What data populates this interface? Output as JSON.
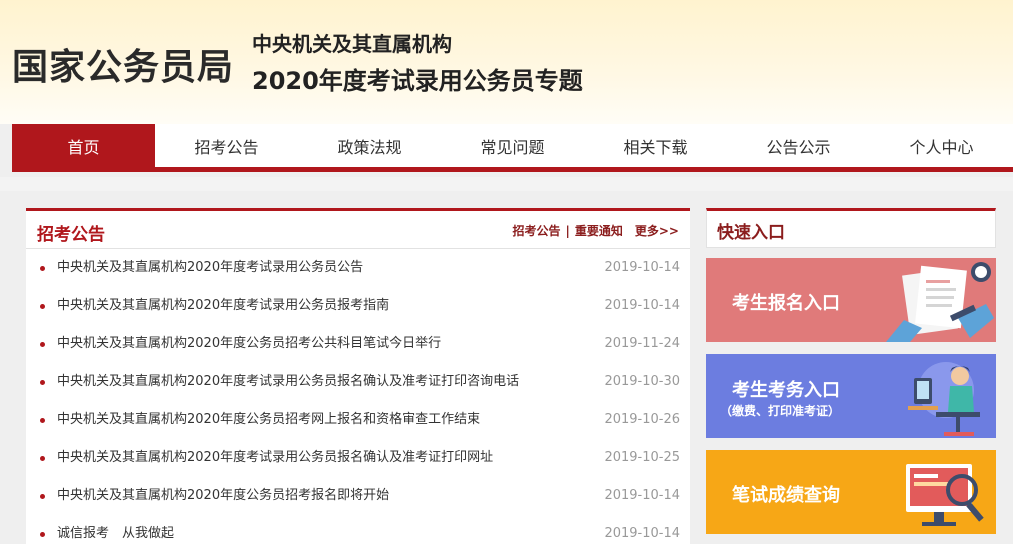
{
  "header": {
    "site_title": "国家公务员局",
    "subtitle_line1": "中央机关及其直属机构",
    "subtitle_line2": "2020年度考试录用公务员专题"
  },
  "nav": {
    "items": [
      {
        "label": "首页",
        "active": true
      },
      {
        "label": "招考公告",
        "active": false
      },
      {
        "label": "政策法规",
        "active": false
      },
      {
        "label": "常见问题",
        "active": false
      },
      {
        "label": "相关下载",
        "active": false
      },
      {
        "label": "公告公示",
        "active": false
      },
      {
        "label": "个人中心",
        "active": false
      }
    ],
    "accent_color": "#b0171c"
  },
  "news": {
    "title": "招考公告",
    "link1": "招考公告",
    "separator": "|",
    "link2": "重要通知",
    "more": "更多>>",
    "items": [
      {
        "text": "中央机关及其直属机构2020年度考试录用公务员公告",
        "date": "2019-10-14"
      },
      {
        "text": "中央机关及其直属机构2020年度考试录用公务员报考指南",
        "date": "2019-10-14"
      },
      {
        "text": "中央机关及其直属机构2020年度公务员招考公共科目笔试今日举行",
        "date": "2019-11-24"
      },
      {
        "text": "中央机关及其直属机构2020年度考试录用公务员报名确认及准考证打印咨询电话",
        "date": "2019-10-30"
      },
      {
        "text": "中央机关及其直属机构2020年度公务员招考网上报名和资格审查工作结束",
        "date": "2019-10-26"
      },
      {
        "text": "中央机关及其直属机构2020年度考试录用公务员报名确认及准考证打印网址",
        "date": "2019-10-25"
      },
      {
        "text": "中央机关及其直属机构2020年度公务员招考报名即将开始",
        "date": "2019-10-14"
      },
      {
        "text": "诚信报考　从我做起",
        "date": "2019-10-14"
      }
    ]
  },
  "quick": {
    "title": "快速入口",
    "banners": [
      {
        "label": "考生报名入口",
        "color": "#e07a7a"
      },
      {
        "label": "考生考务入口",
        "sublabel": "（缴费、打印准考证）",
        "color": "#6c7de0"
      },
      {
        "label": "笔试成绩查询",
        "color": "#f7a716"
      }
    ]
  }
}
